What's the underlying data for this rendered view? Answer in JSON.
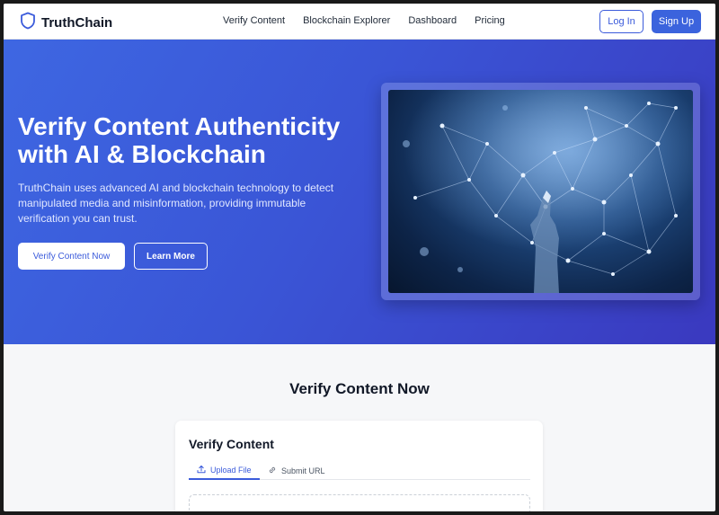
{
  "brand": {
    "name": "TruthChain",
    "logo_icon": "shield-icon"
  },
  "nav": {
    "items": [
      "Verify Content",
      "Blockchain Explorer",
      "Dashboard",
      "Pricing"
    ]
  },
  "auth": {
    "login_label": "Log In",
    "signup_label": "Sign Up"
  },
  "hero": {
    "title": "Verify Content Authenticity with AI & Blockchain",
    "description": "TruthChain uses advanced AI and blockchain technology to detect manipulated media and misinformation, providing immutable verification you can trust.",
    "primary_cta": "Verify Content Now",
    "secondary_cta": "Learn More",
    "image_icon": "ai-network-image"
  },
  "verify_section": {
    "title": "Verify Content Now",
    "card_title": "Verify Content",
    "tabs": [
      {
        "label": "Upload File",
        "icon": "upload-icon"
      },
      {
        "label": "Submit URL",
        "icon": "link-icon"
      }
    ]
  },
  "colors": {
    "accent": "#3b5bdb",
    "hero_gradient_start": "#3e67e2",
    "hero_gradient_end": "#3a39bf"
  }
}
